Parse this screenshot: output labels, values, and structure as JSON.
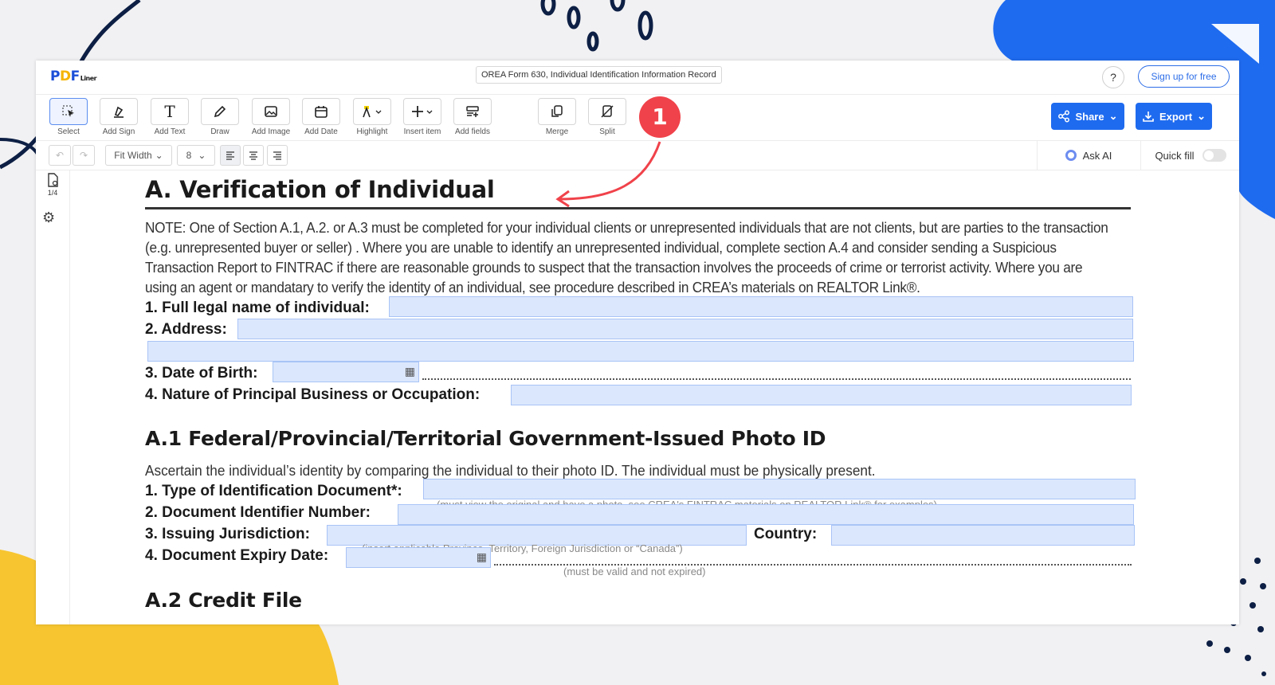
{
  "header": {
    "logo": {
      "p": "P",
      "d": "D",
      "f": "F",
      "liner": "Liner"
    },
    "doc_title": "OREA Form 630, Individual Identification Information Record",
    "help_label": "?",
    "signup_label": "Sign up for free"
  },
  "toolbar": {
    "tools": [
      {
        "label": "Select",
        "icon": "select-cursor-icon",
        "glyph": "⬚"
      },
      {
        "label": "Add Sign",
        "icon": "pen-nib-icon",
        "glyph": "✒"
      },
      {
        "label": "Add Text",
        "icon": "text-icon",
        "glyph": "T"
      },
      {
        "label": "Draw",
        "icon": "pencil-icon",
        "glyph": "✎"
      },
      {
        "label": "Add Image",
        "icon": "image-icon",
        "glyph": "▣"
      },
      {
        "label": "Add Date",
        "icon": "calendar-icon",
        "glyph": "▦"
      },
      {
        "label": "Highlight",
        "icon": "highlighter-icon",
        "glyph": "A"
      },
      {
        "label": "Insert item",
        "icon": "plus-icon",
        "glyph": "+"
      },
      {
        "label": "Add fields",
        "icon": "fields-icon",
        "glyph": "☰"
      },
      {
        "label": "Merge",
        "icon": "merge-icon",
        "glyph": "⧉"
      },
      {
        "label": "Split",
        "icon": "split-icon",
        "glyph": "⊘"
      }
    ],
    "share_label": "Share",
    "export_label": "Export"
  },
  "format_bar": {
    "undo": "↶",
    "redo": "↷",
    "zoom": "Fit Width",
    "font_size": "8",
    "ask_ai": "Ask AI",
    "quick_fill": "Quick fill"
  },
  "rail": {
    "page_indicator": "1/4"
  },
  "document": {
    "heading": "A. Verification of Individual",
    "note_lines": [
      "NOTE: One of Section A.1, A.2. or A.3 must be completed for your individual clients or unrepresented individuals that are not clients, but are parties to the transaction",
      "(e.g. unrepresented buyer or seller) . Where you are unable to identify an unrepresented individual, complete section A.4 and consider sending a Suspicious",
      "Transaction Report to FINTRAC if there are reasonable grounds to suspect that the transaction involves the proceeds of crime or terrorist activity. Where you are",
      "using an agent or mandatary to verify the identity of an individual, see procedure described in CREA’s materials on REALTOR Link®."
    ],
    "fields": {
      "full_name": "1. Full legal name of individual:",
      "address": "2. Address:",
      "dob": "3. Date of Birth:",
      "occupation": "4. Nature of Principal Business or Occupation:"
    },
    "section_a1": {
      "heading": "A.1 Federal/Provincial/Territorial Government-Issued Photo ID",
      "intro": "Ascertain the individual’s identity by comparing the individual to their photo ID. The individual must be physically present.",
      "id_type": "1. Type of Identification Document*:",
      "id_type_hint": "(must view the original and have a photo, see CREA's FINTRAC materials on REALTOR Link® for examples)",
      "doc_number": "2. Document Identifier Number:",
      "jurisdiction": "3. Issuing Jurisdiction:",
      "jurisdiction_hint": "(insert applicable Province, Territory, Foreign Jurisdiction or “Canada”)",
      "country": "Country:",
      "expiry": "4. Document Expiry Date:",
      "expiry_hint": "(must be valid and not expired)"
    },
    "section_a2": {
      "heading": "A.2 Credit File"
    }
  },
  "annotation": {
    "step": "1"
  },
  "colors": {
    "accent": "#1f6bef",
    "field_fill": "#dbe7fd",
    "badge": "#f0424a"
  }
}
